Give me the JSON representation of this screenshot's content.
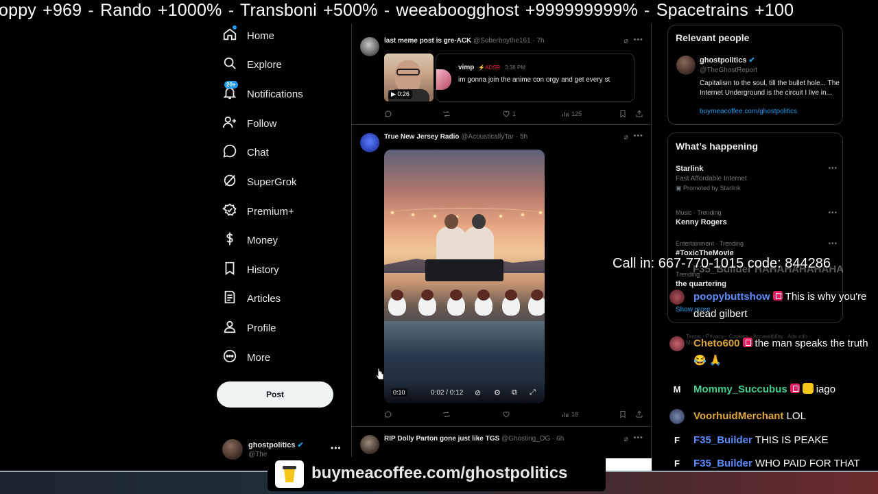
{
  "ticker": {
    "text": "oppy +969  -  Rando +1000%   -  Transboni +500%  -  weeaboogghost +999999999%  -  Spacetrains +100"
  },
  "nav": {
    "items": [
      {
        "label": "Home",
        "icon": "home-icon"
      },
      {
        "label": "Explore",
        "icon": "search-icon"
      },
      {
        "label": "Notifications",
        "icon": "bell-icon",
        "badge": "20+"
      },
      {
        "label": "Follow",
        "icon": "follow-icon"
      },
      {
        "label": "Chat",
        "icon": "chat-icon"
      },
      {
        "label": "SuperGrok",
        "icon": "grok-icon"
      },
      {
        "label": "Premium+",
        "icon": "premium-icon"
      },
      {
        "label": "Money",
        "icon": "money-icon"
      },
      {
        "label": "History",
        "icon": "bookmark-icon"
      },
      {
        "label": "Articles",
        "icon": "articles-icon"
      },
      {
        "label": "Profile",
        "icon": "profile-icon"
      },
      {
        "label": "More",
        "icon": "more-circle-icon"
      }
    ],
    "post_label": "Post",
    "account": {
      "name": "ghostpolitics",
      "handle": "@The"
    }
  },
  "timeline": {
    "post1": {
      "name": "last meme post is gre-ACK",
      "meta": "@Soberboythe161 · 7h",
      "video_duration": "0:26",
      "quote": {
        "name": "vimp",
        "tag": "⚡ADSR",
        "time": "3:38 PM",
        "text": "im gonna join the anime con orgy and get every st"
      },
      "replies": "",
      "reposts": "",
      "likes": "1",
      "views": "125"
    },
    "post2": {
      "name": "True New Jersey Radio",
      "meta": "@AcousticallyTar · 5h",
      "video_time": "0:10",
      "video_progress": "0:02 / 0:12",
      "likes": "",
      "views": "18"
    },
    "post3": {
      "name": "RIP Dolly Parton gone just like TGS",
      "meta": "@Ghosting_OG · 6h"
    }
  },
  "relevant": {
    "heading": "Relevant people",
    "name": "ghostpolitics",
    "handle": "@TheGhostReport",
    "bio": "Capitalism to the soul, till the bullet hole... The Internet Underground is the circuit I live in...",
    "link": "buymeacoffee.com/ghostpolitics"
  },
  "happening": {
    "heading": "What’s happening",
    "trends": [
      {
        "meta": "",
        "title": "Starlink",
        "sub": "Fast Affordable Internet",
        "promo": "Promoted by Starlink"
      },
      {
        "meta": "Music · Trending",
        "title": "Kenny Rogers",
        "sub": "",
        "promo": ""
      },
      {
        "meta": "Entertainment · Trending",
        "title": "#ToxicTheMovie",
        "sub": "",
        "promo": ""
      },
      {
        "meta": "Trending",
        "title": "the quartering",
        "sub": "",
        "promo": ""
      }
    ],
    "show_more": "Show more"
  },
  "footer_links": "Terms · Privacy · Cookies · Accessibility · Ads info · More · © 2025 X Corp.",
  "overlay": {
    "call_in": "Call in: 667-770-1015 code: 844286",
    "partial_chat": "F35_Builder HAHAHAHAHAHA",
    "chat": [
      {
        "avatar": "",
        "user": "poopybuttshow",
        "user_color": "#5b8cff",
        "badge": "sub",
        "text": "This is why you're dead gilbert"
      },
      {
        "avatar": "",
        "user": "Cheto600",
        "user_color": "#d9a23a",
        "badge": "sub",
        "text": "the man speaks the truth 😂 🙏"
      },
      {
        "avatar": "M",
        "user": "Mommy_Succubus",
        "user_color": "#3ecf8e",
        "badge": "sub+emote",
        "text": "iago"
      },
      {
        "avatar": "",
        "user": "VoorhuidMerchant",
        "user_color": "#e0a83a",
        "badge": "",
        "text": "LOL"
      },
      {
        "avatar": "F",
        "user": "F35_Builder",
        "user_color": "#5b8cff",
        "badge": "",
        "text": "THIS IS PEAKE"
      },
      {
        "avatar": "F",
        "user": "F35_Builder",
        "user_color": "#5b8cff",
        "badge": "",
        "text": "WHO PAID FOR THAT"
      }
    ],
    "coffee_text": "buymeacoffee.com/ghostpolitics"
  },
  "colors": {
    "accent": "#1d9bf0",
    "background": "#000000",
    "text": "#e7e9ea",
    "muted": "#71767b"
  }
}
